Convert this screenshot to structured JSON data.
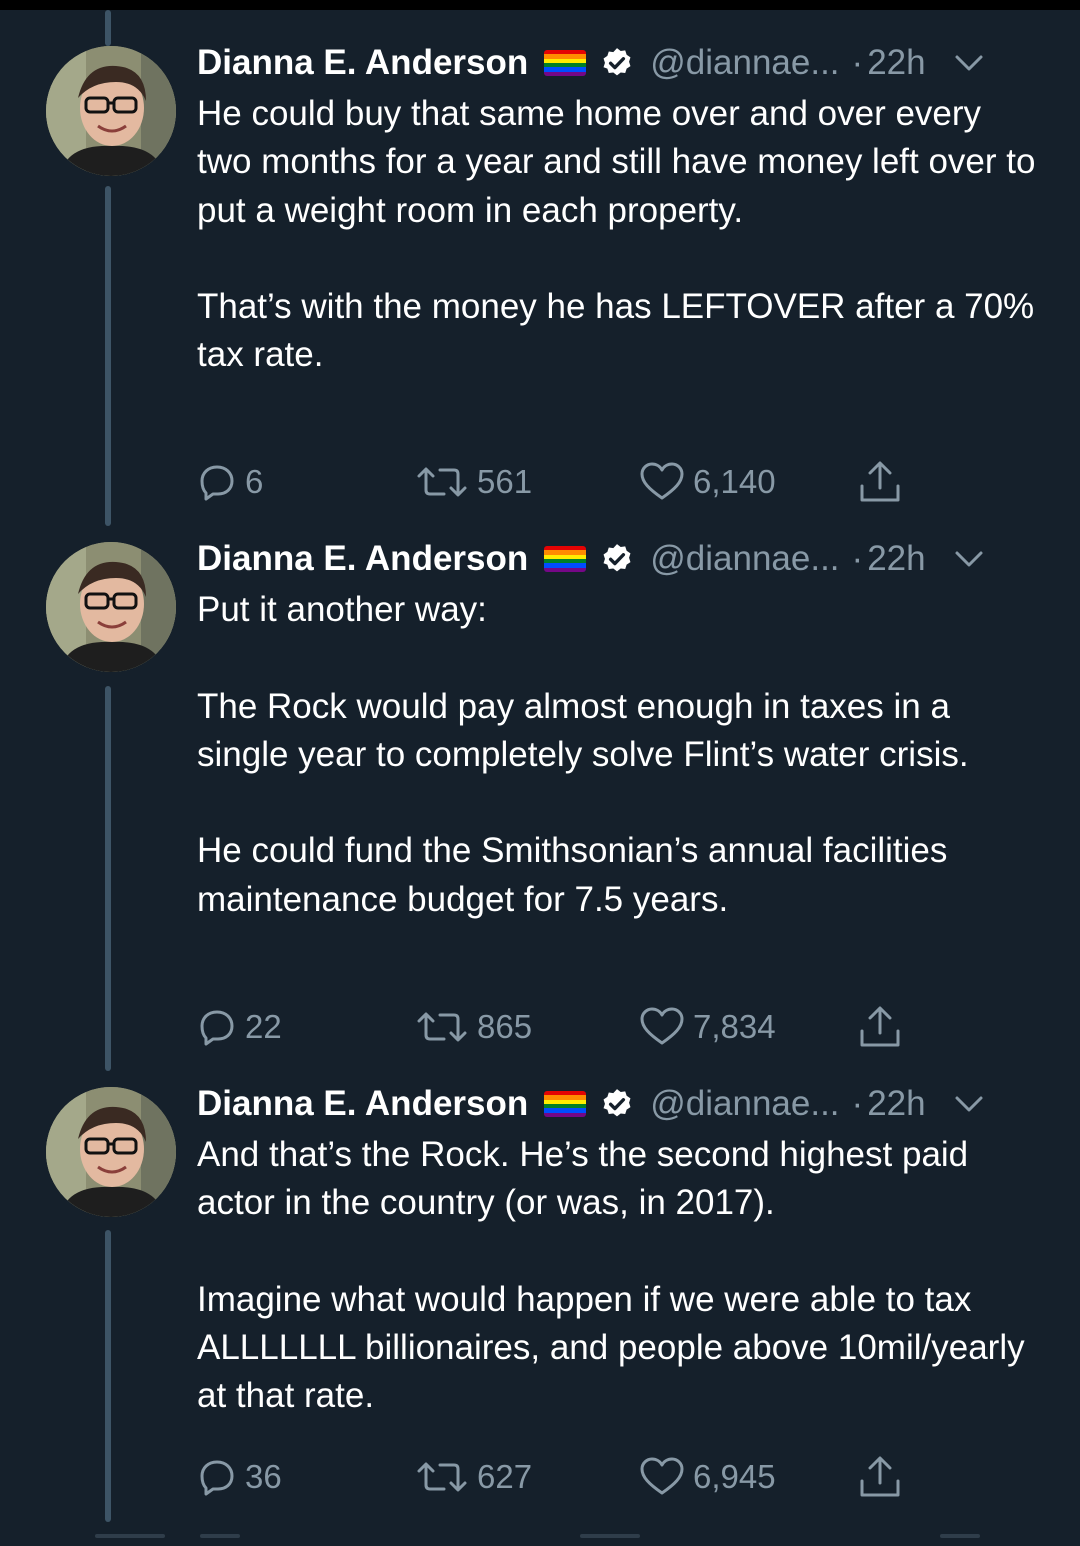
{
  "colors": {
    "background": "#15202b",
    "primary_text": "#ffffff",
    "secondary_text": "#8899a6",
    "thread_line": "#3d5466",
    "verified_badge": "#ffffff"
  },
  "tweets": [
    {
      "author": "Dianna E. Anderson",
      "handle": "@diannae...",
      "dot": "·",
      "time": "22h",
      "paragraphs": [
        "He could buy that same home over and over every two months for a year and still have money left over to put a weight room in each property.",
        "That’s with the money he has LEFTOVER after a 70% tax rate."
      ],
      "replies": "6",
      "retweets": "561",
      "likes": "6,140"
    },
    {
      "author": "Dianna E. Anderson",
      "handle": "@diannae...",
      "dot": "·",
      "time": "22h",
      "paragraphs": [
        "Put it another way:",
        "The Rock would pay almost enough in taxes in a single year to completely solve Flint’s water crisis.",
        "He could fund the Smithsonian’s annual facilities maintenance budget for 7.5 years."
      ],
      "replies": "22",
      "retweets": "865",
      "likes": "7,834"
    },
    {
      "author": "Dianna E. Anderson",
      "handle": "@diannae...",
      "dot": "·",
      "time": "22h",
      "paragraphs": [
        "And that’s the Rock. He’s the second highest paid actor in the country (or was, in 2017).",
        "Imagine what would happen if we were able to tax ALLLLLLL billionaires, and people above 10mil/yearly at that rate."
      ],
      "replies": "36",
      "retweets": "627",
      "likes": "6,945"
    }
  ],
  "icons": {
    "avatar": "avatar-icon",
    "flag": "rainbow-flag-icon",
    "verified": "verified-badge-icon",
    "caret": "chevron-down-icon",
    "reply": "reply-icon",
    "retweet": "retweet-icon",
    "like": "heart-icon",
    "share": "share-icon"
  }
}
